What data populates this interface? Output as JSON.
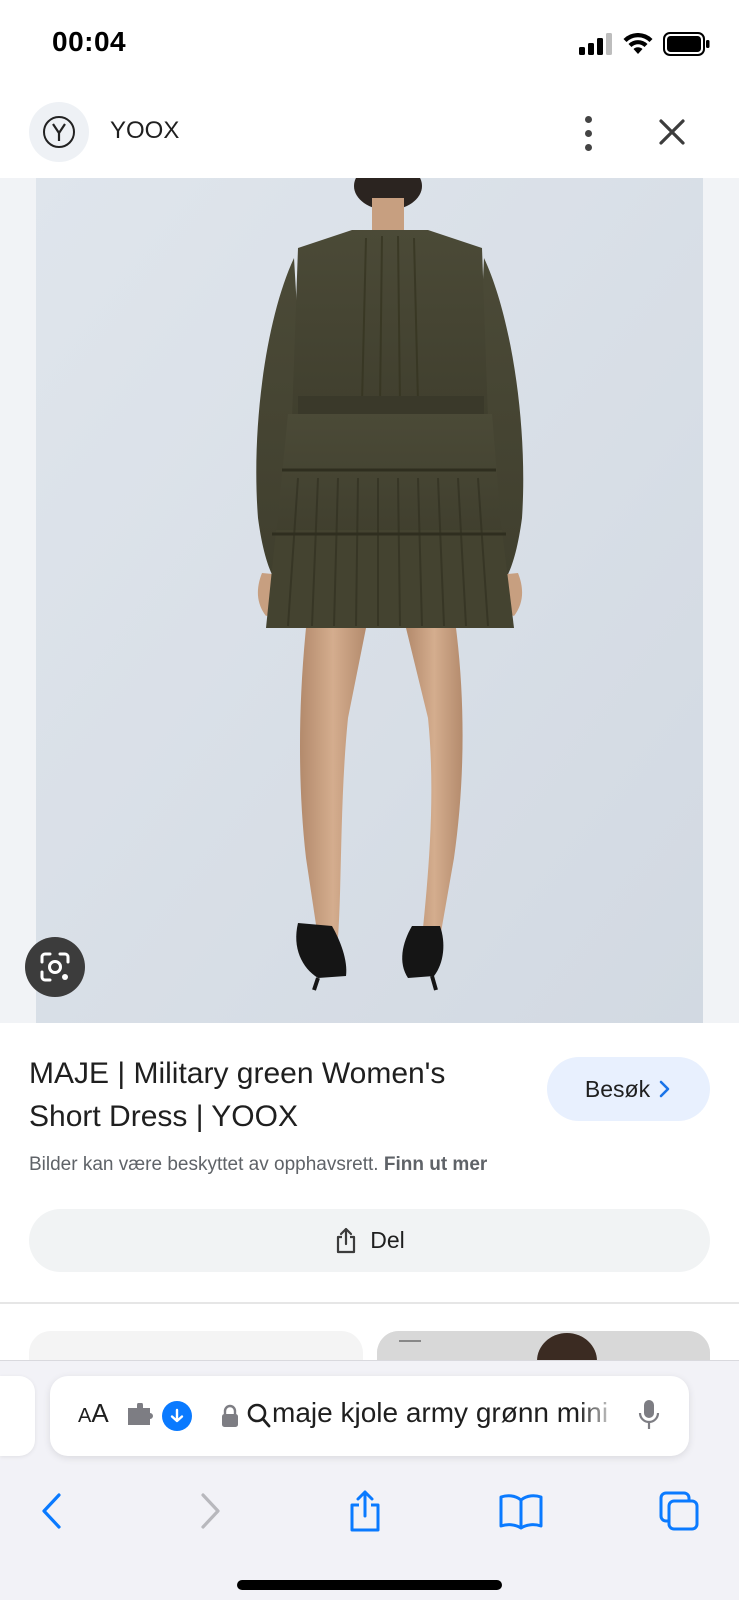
{
  "status_bar": {
    "time": "00:04"
  },
  "source": {
    "name": "YOOX",
    "logo_letter": "Y"
  },
  "result": {
    "title": "MAJE | Military green Women's Short Dress | YOOX",
    "visit_label": "Besøk",
    "copyright_text": "Bilder kan være beskyttet av opphavsrett.",
    "copyright_link": "Finn ut mer",
    "share_label": "Del"
  },
  "address_bar": {
    "text_size_label": "AA",
    "query": "maje kjole army grønn mini"
  },
  "colors": {
    "accent_blue": "#0a7aff",
    "visit_button_bg": "#e8f0fe",
    "share_button_bg": "#f1f3f4",
    "dress_color": "#4a4a36"
  },
  "icons": [
    "signal-icon",
    "wifi-icon",
    "battery-icon",
    "more-vert-icon",
    "close-icon",
    "google-lens-icon",
    "chevron-right-icon",
    "share-icon",
    "extension-icon",
    "download-icon",
    "lock-icon",
    "search-icon",
    "mic-icon",
    "back-icon",
    "forward-icon",
    "share-icon",
    "bookmarks-icon",
    "tabs-icon"
  ]
}
